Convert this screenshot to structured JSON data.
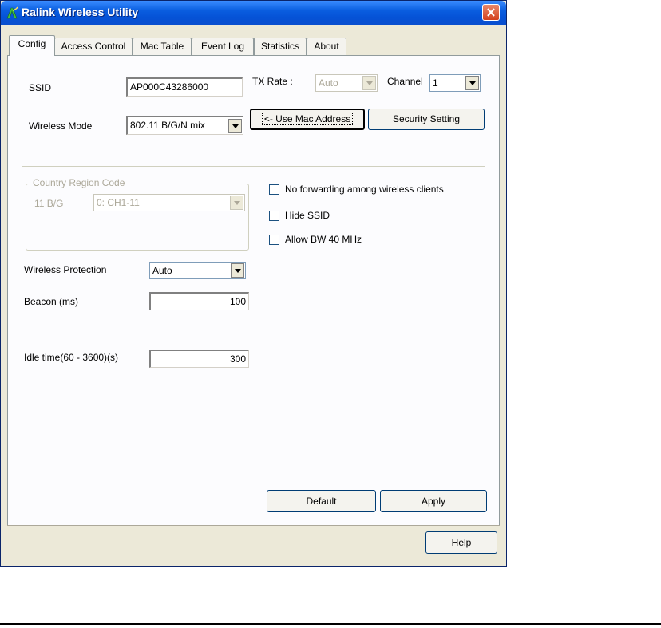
{
  "window": {
    "title": "Ralink Wireless Utility"
  },
  "tabs": [
    "Config",
    "Access Control",
    "Mac Table",
    "Event Log",
    "Statistics",
    "About"
  ],
  "config": {
    "ssid_label": "SSID",
    "ssid_value": "AP000C43286000",
    "tx_rate_label": "TX Rate :",
    "tx_rate_value": "Auto",
    "channel_label": "Channel",
    "channel_value": "1",
    "wireless_mode_label": "Wireless Mode",
    "wireless_mode_value": "802.11 B/G/N mix",
    "use_mac_button": "<- Use Mac Address",
    "security_button": "Security Setting",
    "country_group_label": "Country Region Code",
    "country_band_label": "11 B/G",
    "country_value": "0: CH1-11",
    "no_forwarding_label": "No forwarding among wireless clients",
    "hide_ssid_label": "Hide SSID",
    "allow_bw_label": "Allow BW 40 MHz",
    "protection_label": "Wireless Protection",
    "protection_value": "Auto",
    "beacon_label": "Beacon (ms)",
    "beacon_value": "100",
    "idle_label": "Idle time(60 - 3600)(s)",
    "idle_value": "300",
    "default_button": "Default",
    "apply_button": "Apply"
  },
  "help_button": "Help"
}
